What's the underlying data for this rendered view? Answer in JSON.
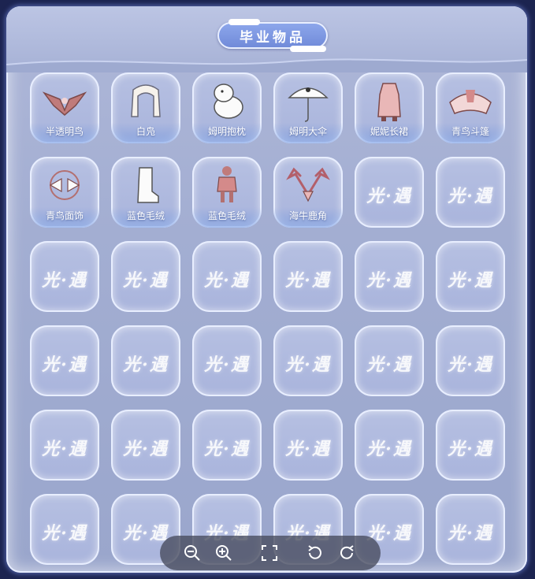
{
  "title": "毕业物品",
  "watermark_text": "光·遇",
  "items": [
    {
      "label": "半透明鸟",
      "icon": "bird-wings-icon"
    },
    {
      "label": "白凫",
      "icon": "white-hair-icon"
    },
    {
      "label": "姆明抱枕",
      "icon": "moomin-plush-icon"
    },
    {
      "label": "姆明大伞",
      "icon": "umbrella-icon"
    },
    {
      "label": "妮妮长裙",
      "icon": "long-dress-icon"
    },
    {
      "label": "青鸟斗篷",
      "icon": "cape-icon"
    },
    {
      "label": "青鸟面饰",
      "icon": "face-mask-icon"
    },
    {
      "label": "蓝色毛绒",
      "icon": "boot-icon"
    },
    {
      "label": "蓝色毛绒",
      "icon": "outfit-icon"
    },
    {
      "label": "海牛鹿角",
      "icon": "antlers-icon"
    }
  ],
  "empty_slot_count": 26,
  "toolbar": [
    "zoom-out-icon",
    "zoom-in-icon",
    "fullscreen-icon",
    "rotate-left-icon",
    "rotate-right-icon"
  ],
  "colors": {
    "panel": "#a3aed2",
    "pill": "#7f98e2",
    "accent": "#e8eeff",
    "toolbar": "#464a5c"
  }
}
